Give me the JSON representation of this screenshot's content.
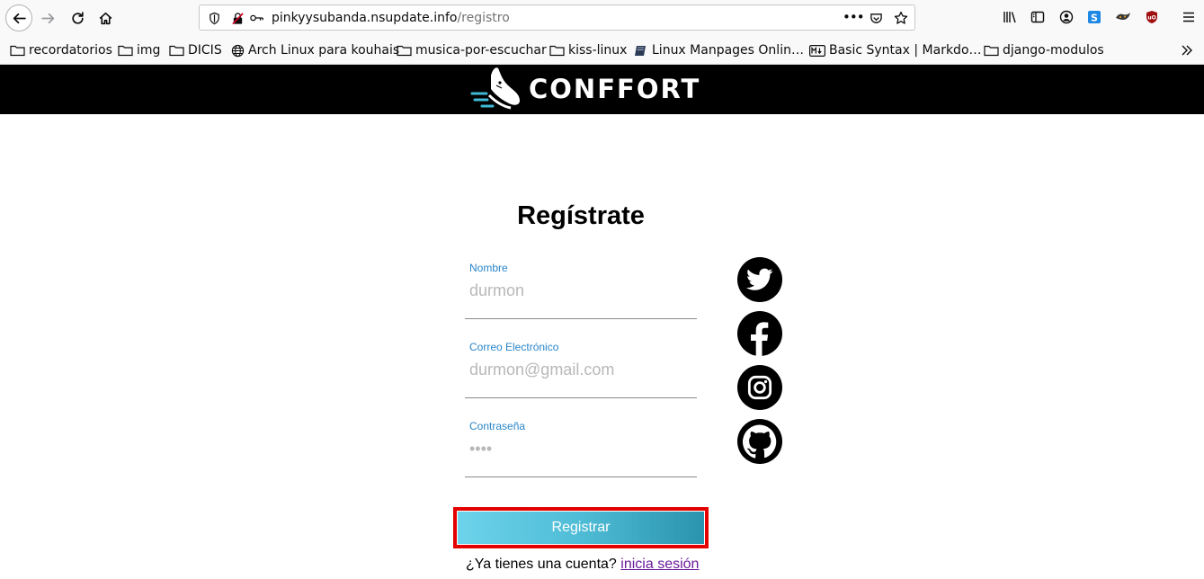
{
  "browser": {
    "url_host": "pinkyysubanda.nsupdate.info",
    "url_path": "/registro",
    "url_more": "•••"
  },
  "bookmarks": [
    {
      "label": "recordatorios",
      "icon": "folder-icon"
    },
    {
      "label": "img",
      "icon": "folder-icon"
    },
    {
      "label": "DICIS",
      "icon": "folder-icon"
    },
    {
      "label": "Arch Linux para kouhais",
      "icon": "globe-icon"
    },
    {
      "label": "musica-por-escuchar",
      "icon": "folder-icon"
    },
    {
      "label": "kiss-linux",
      "icon": "folder-icon"
    },
    {
      "label": "Linux Manpages Onlin…",
      "icon": "book-icon"
    },
    {
      "label": "Basic Syntax | Markdo…",
      "icon": "markdown-icon"
    },
    {
      "label": "django-modulos",
      "icon": "folder-icon"
    }
  ],
  "site": {
    "brand": "CONFFORT"
  },
  "form": {
    "title": "Regístrate",
    "name_label": "Nombre",
    "name_placeholder": "durmon",
    "email_label": "Correo Electrónico",
    "email_placeholder": "durmon@gmail.com",
    "password_label": "Contraseña",
    "password_placeholder": "••••",
    "submit_label": "Registrar",
    "login_prompt": "¿Ya tienes una cuenta?",
    "login_link": "inicia sesión"
  },
  "social": [
    "twitter-icon",
    "facebook-icon",
    "instagram-icon",
    "github-icon"
  ],
  "colors": {
    "accent_blue": "#2a86c9",
    "button_gradient_start": "#6cd3ea",
    "button_gradient_end": "#2a93ad",
    "highlight_red": "#e50000",
    "header_bg": "#000000"
  }
}
